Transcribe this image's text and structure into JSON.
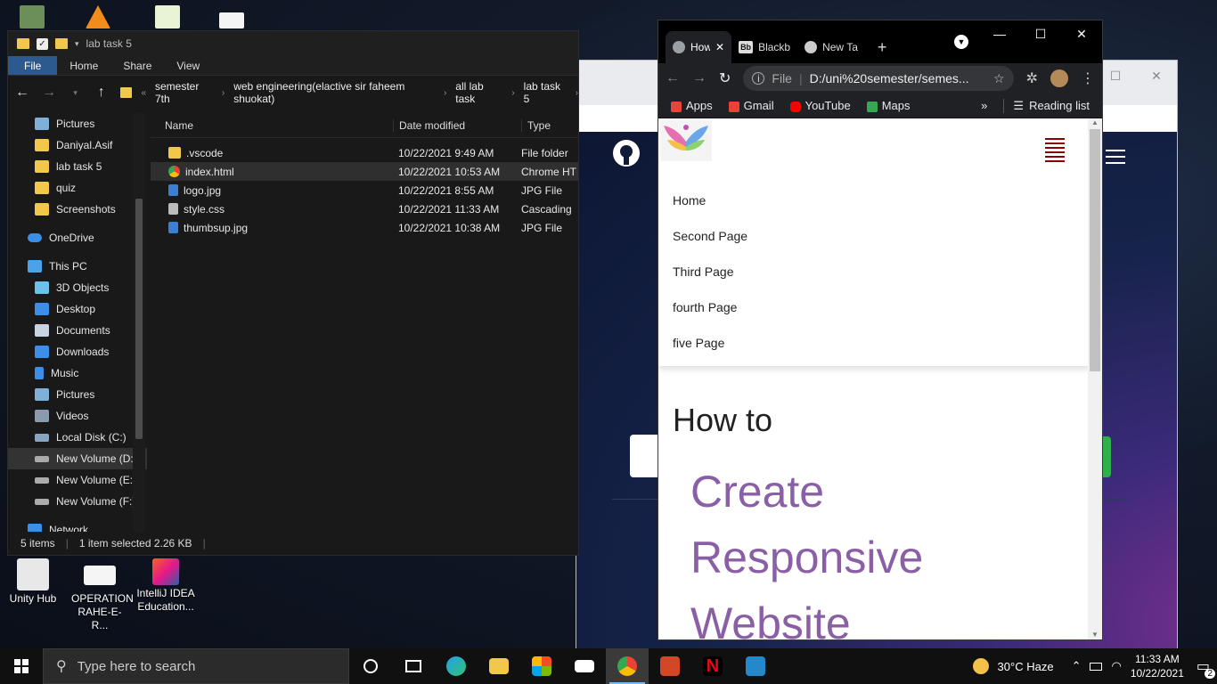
{
  "desktop": {
    "icons": [
      {
        "label": "Unity Hub"
      },
      {
        "label": "OPERATION RAHE-E-R..."
      },
      {
        "label": "IntelliJ IDEA Education..."
      }
    ]
  },
  "explorer": {
    "title": "lab task 5",
    "ribbon_tabs": [
      "File",
      "Home",
      "Share",
      "View"
    ],
    "breadcrumb": [
      "semester 7th",
      "web engineering(elactive sir faheem shuokat)",
      "all lab task",
      "lab task 5"
    ],
    "sidebar": [
      {
        "label": "Pictures",
        "color": "#7fb0d8"
      },
      {
        "label": "Daniyal.Asif",
        "color": "#f2c84b"
      },
      {
        "label": "lab task 5",
        "color": "#f2c84b"
      },
      {
        "label": "quiz",
        "color": "#f2c84b"
      },
      {
        "label": "Screenshots",
        "color": "#f2c84b"
      },
      {
        "label": "OneDrive",
        "color": "#3d8ee6"
      },
      {
        "label": "This PC",
        "color": "#4aa3e8"
      },
      {
        "label": "3D Objects",
        "color": "#6bc1e8"
      },
      {
        "label": "Desktop",
        "color": "#3d8ee6"
      },
      {
        "label": "Documents",
        "color": "#c9d4e0"
      },
      {
        "label": "Downloads",
        "color": "#3d8ee6"
      },
      {
        "label": "Music",
        "color": "#3d8ee6"
      },
      {
        "label": "Pictures",
        "color": "#7fb0d8"
      },
      {
        "label": "Videos",
        "color": "#8a9bb0"
      },
      {
        "label": "Local Disk (C:)",
        "color": "#8aa4bf"
      },
      {
        "label": "New Volume (D:",
        "color": "#aaaaaa"
      },
      {
        "label": "New Volume (E:)",
        "color": "#aaaaaa"
      },
      {
        "label": "New Volume (F:)",
        "color": "#aaaaaa"
      },
      {
        "label": "Network",
        "color": "#3d8ee6"
      }
    ],
    "columns": [
      "Name",
      "Date modified",
      "Type"
    ],
    "files": [
      {
        "name": ".vscode",
        "date": "10/22/2021 9:49 AM",
        "type": "File folder",
        "color": "#f2c84b"
      },
      {
        "name": "index.html",
        "date": "10/22/2021 10:53 AM",
        "type": "Chrome HT",
        "color": "#e0a020"
      },
      {
        "name": "logo.jpg",
        "date": "10/22/2021 8:55 AM",
        "type": "JPG File",
        "color": "#3b7fd4"
      },
      {
        "name": "style.css",
        "date": "10/22/2021 11:33 AM",
        "type": "Cascading",
        "color": "#bbbbbb"
      },
      {
        "name": "thumbsup.jpg",
        "date": "10/22/2021 10:38 AM",
        "type": "JPG File",
        "color": "#3b7fd4"
      }
    ],
    "status": {
      "items": "5 items",
      "selected": "1 item selected  2.26 KB"
    }
  },
  "chrome": {
    "tabs": [
      {
        "label": "How"
      },
      {
        "label": "Blackb"
      },
      {
        "label": "New Ta"
      }
    ],
    "url_prefix": "File",
    "url": "D:/uni%20semester/semes...",
    "bookmarks": [
      {
        "label": "Apps",
        "color": "#e8453c"
      },
      {
        "label": "Gmail",
        "color": "#ea4335"
      },
      {
        "label": "YouTube",
        "color": "#ff0000"
      },
      {
        "label": "Maps",
        "color": "#34a853"
      }
    ],
    "reading_list": "Reading list",
    "page": {
      "menu": [
        "Home",
        "Second Page",
        "Third Page",
        "fourth Page",
        "five Page"
      ],
      "heading": "How to",
      "hero_lines": [
        "Create",
        "Responsive",
        "Website"
      ]
    }
  },
  "taskbar": {
    "search_placeholder": "Type here to search",
    "weather": "30°C  Haze",
    "time": "11:33 AM",
    "date": "10/22/2021",
    "notifications": "2"
  }
}
